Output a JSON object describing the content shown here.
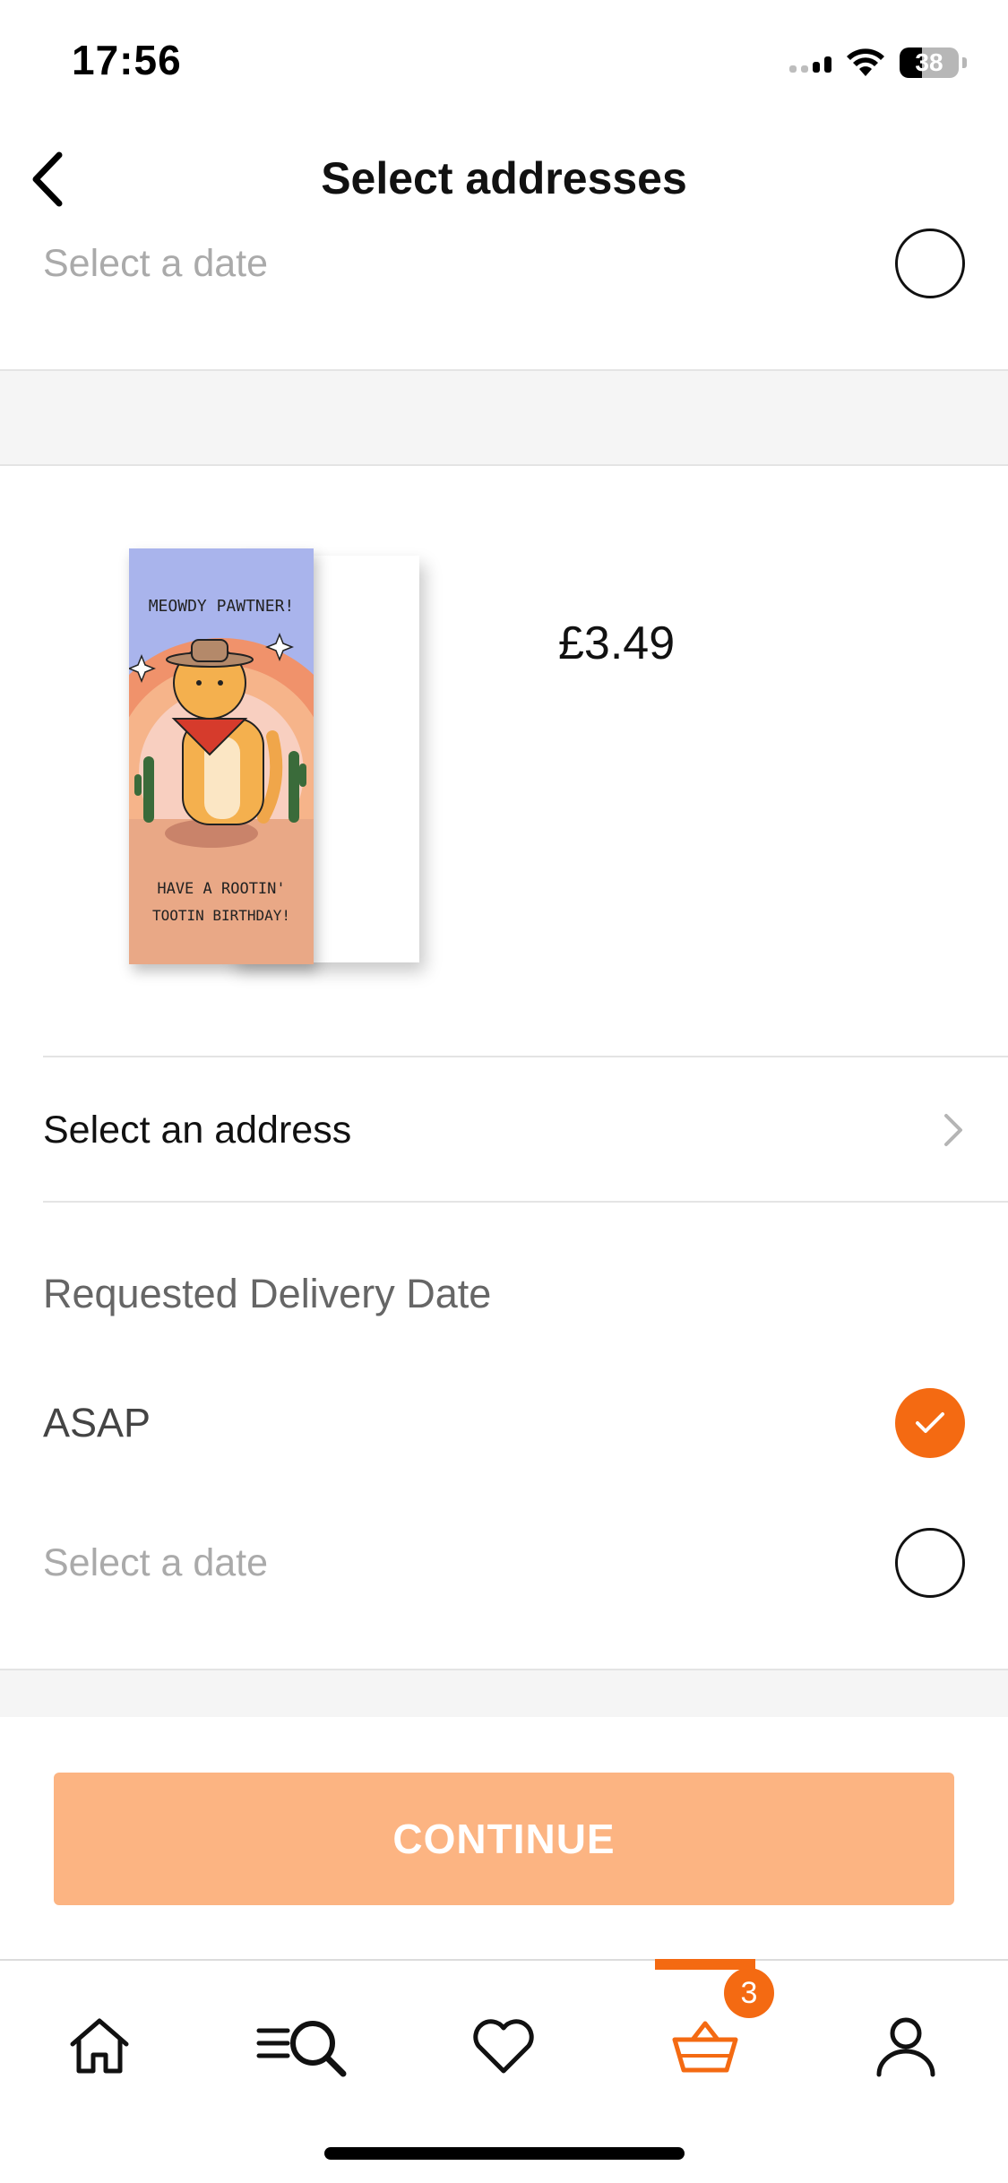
{
  "status_bar": {
    "time": "17:56",
    "battery": "38",
    "battery_level": 0.38
  },
  "header": {
    "title": "Select addresses",
    "back_icon": "chevron-left-icon"
  },
  "top_date_option": {
    "label": "Select a date",
    "selected": false
  },
  "product": {
    "card_text_top": "MEOWDY PAWTNER!",
    "card_text_bottom_1": "HAVE A ROOTIN'",
    "card_text_bottom_2": "TOOTIN BIRTHDAY!",
    "price": "£3.49"
  },
  "address": {
    "label": "Select an address",
    "icon": "chevron-right-icon"
  },
  "delivery": {
    "section_label": "Requested Delivery Date",
    "options": [
      {
        "label": "ASAP",
        "selected": true
      },
      {
        "label": "Select a date",
        "selected": false
      }
    ]
  },
  "continue_label": "CONTINUE",
  "tab_bar": {
    "items": [
      {
        "name": "home-icon",
        "active": false
      },
      {
        "name": "browse-search-icon",
        "active": false
      },
      {
        "name": "heart-icon",
        "active": false
      },
      {
        "name": "basket-icon",
        "active": true
      },
      {
        "name": "account-icon",
        "active": false
      }
    ],
    "basket_count": "3"
  },
  "colors": {
    "accent": "#f46a12",
    "continue_bg": "#fcb482",
    "muted": "#aaaaaa"
  }
}
